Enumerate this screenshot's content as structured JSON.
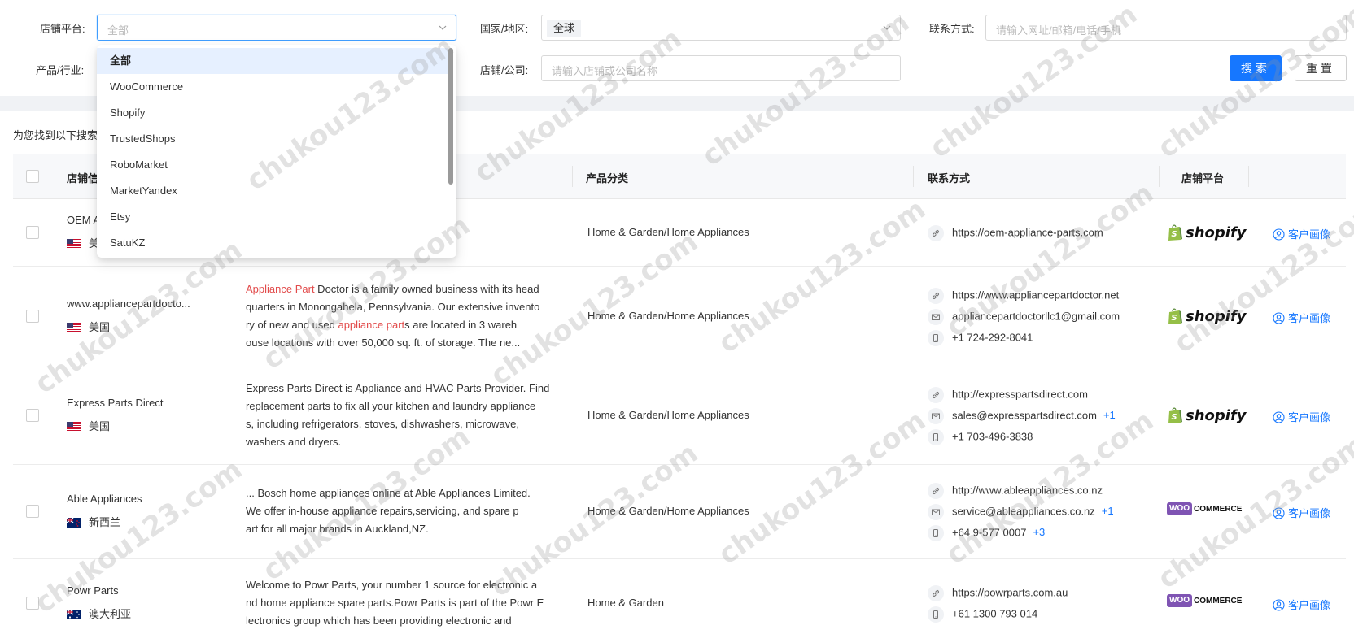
{
  "filters": {
    "platform_label": "店铺平台:",
    "platform_placeholder": "全部",
    "country_label": "国家/地区:",
    "country_tag": "全球",
    "contact_label": "联系方式:",
    "contact_placeholder": "请输入网址/邮箱/电话/手机",
    "industry_label": "产品/行业:",
    "company_label": "店铺/公司:",
    "company_placeholder": "请输入店铺或公司名称",
    "search_button": "搜索",
    "reset_button": "重置"
  },
  "dropdown": {
    "options": [
      "全部",
      "WooCommerce",
      "Shopify",
      "TrustedShops",
      "RoboMarket",
      "MarketYandex",
      "Etsy",
      "SatuKZ"
    ],
    "selected": "全部"
  },
  "results": {
    "title": "为您找到以下搜索",
    "columns": [
      "店铺信",
      "产品分类",
      "联系方式",
      "店铺平台"
    ]
  },
  "rows": [
    {
      "name": "OEM A",
      "country": "美",
      "flag": "us",
      "desc": [],
      "category": "Home & Garden/Home Appliances",
      "contacts": [
        {
          "type": "link",
          "text": "https://oem-appliance-parts.com"
        }
      ],
      "platform": "shopify",
      "platform_text": "shopify",
      "action": "客户画像"
    },
    {
      "name": "www.appliancepartdocto...",
      "country": "美国",
      "flag": "us",
      "desc": [
        [
          {
            "t": "Appliance Part",
            "h": true
          },
          {
            "t": " Doctor is a family owned business with its head"
          }
        ],
        [
          {
            "t": "quarters in Monongahela, Pennsylvania. Our extensive invento"
          }
        ],
        [
          {
            "t": "ry of new and used "
          },
          {
            "t": "appliance part",
            "h": true
          },
          {
            "t": "s are located in 3 wareh"
          }
        ],
        [
          {
            "t": "ouse locations with over 50,000 sq. ft. of storage. The ne..."
          }
        ]
      ],
      "category": "Home & Garden/Home Appliances",
      "contacts": [
        {
          "type": "link",
          "text": "https://www.appliancepartdoctor.net"
        },
        {
          "type": "mail",
          "text": "appliancepartdoctorllc1@gmail.com"
        },
        {
          "type": "phone",
          "text": "+1 724-292-8041"
        }
      ],
      "platform": "shopify",
      "platform_text": "shopify",
      "action": "客户画像"
    },
    {
      "name": "Express Parts Direct",
      "country": "美国",
      "flag": "us",
      "desc": [
        [
          {
            "t": "Express Parts Direct is Appliance and HVAC Parts Provider. Find"
          }
        ],
        [
          {
            "t": "replacement parts to fix all your kitchen and laundry appliance"
          }
        ],
        [
          {
            "t": "s, including refrigerators, stoves, dishwashers, microwave,"
          }
        ],
        [
          {
            "t": "washers and dryers."
          }
        ]
      ],
      "category": "Home & Garden/Home Appliances",
      "contacts": [
        {
          "type": "link",
          "text": "http://expresspartsdirect.com"
        },
        {
          "type": "mail",
          "text": "sales@expresspartsdirect.com",
          "more": "+1"
        },
        {
          "type": "phone",
          "text": "+1 703-496-3838"
        }
      ],
      "platform": "shopify",
      "platform_text": "shopify",
      "action": "客户画像"
    },
    {
      "name": "Able Appliances",
      "country": "新西兰",
      "flag": "nz",
      "desc": [
        [
          {
            "t": "... Bosch home appliances online at Able Appliances Limited."
          }
        ],
        [
          {
            "t": "We offer in-house appliance repairs,servicing, and spare p"
          }
        ],
        [
          {
            "t": "art for all major brands in Auckland,NZ."
          }
        ]
      ],
      "category": "Home & Garden/Home Appliances",
      "contacts": [
        {
          "type": "link",
          "text": "http://www.ableappliances.co.nz"
        },
        {
          "type": "mail",
          "text": "service@ableappliances.co.nz",
          "more": "+1"
        },
        {
          "type": "phone",
          "text": "+64 9-577 0007",
          "more": "+3"
        }
      ],
      "platform": "woo",
      "platform_text": "COMMERCE",
      "platform_box": "WOO",
      "action": "客户画像"
    },
    {
      "name": "Powr Parts",
      "country": "澳大利亚",
      "flag": "au",
      "desc": [
        [
          {
            "t": "Welcome to Powr Parts, your number 1 source for electronic a"
          }
        ],
        [
          {
            "t": "nd home appliance spare parts.Powr Parts is part of the Powr E"
          }
        ],
        [
          {
            "t": "lectronics group which has been providing electronic and"
          }
        ]
      ],
      "category": "Home & Garden",
      "contacts": [
        {
          "type": "link",
          "text": "https://powrparts.com.au"
        },
        {
          "type": "phone",
          "text": "+61 1300 793 014"
        }
      ],
      "platform": "woo",
      "platform_text": "COMMERCE",
      "platform_box": "WOO",
      "action": "客户画像"
    }
  ],
  "watermark": "chukou123.com",
  "colors": {
    "accent": "#1677ff",
    "highlight": "#e24b4b",
    "shopify_green": "#95bf47",
    "woo_purple": "#7f54b3"
  }
}
